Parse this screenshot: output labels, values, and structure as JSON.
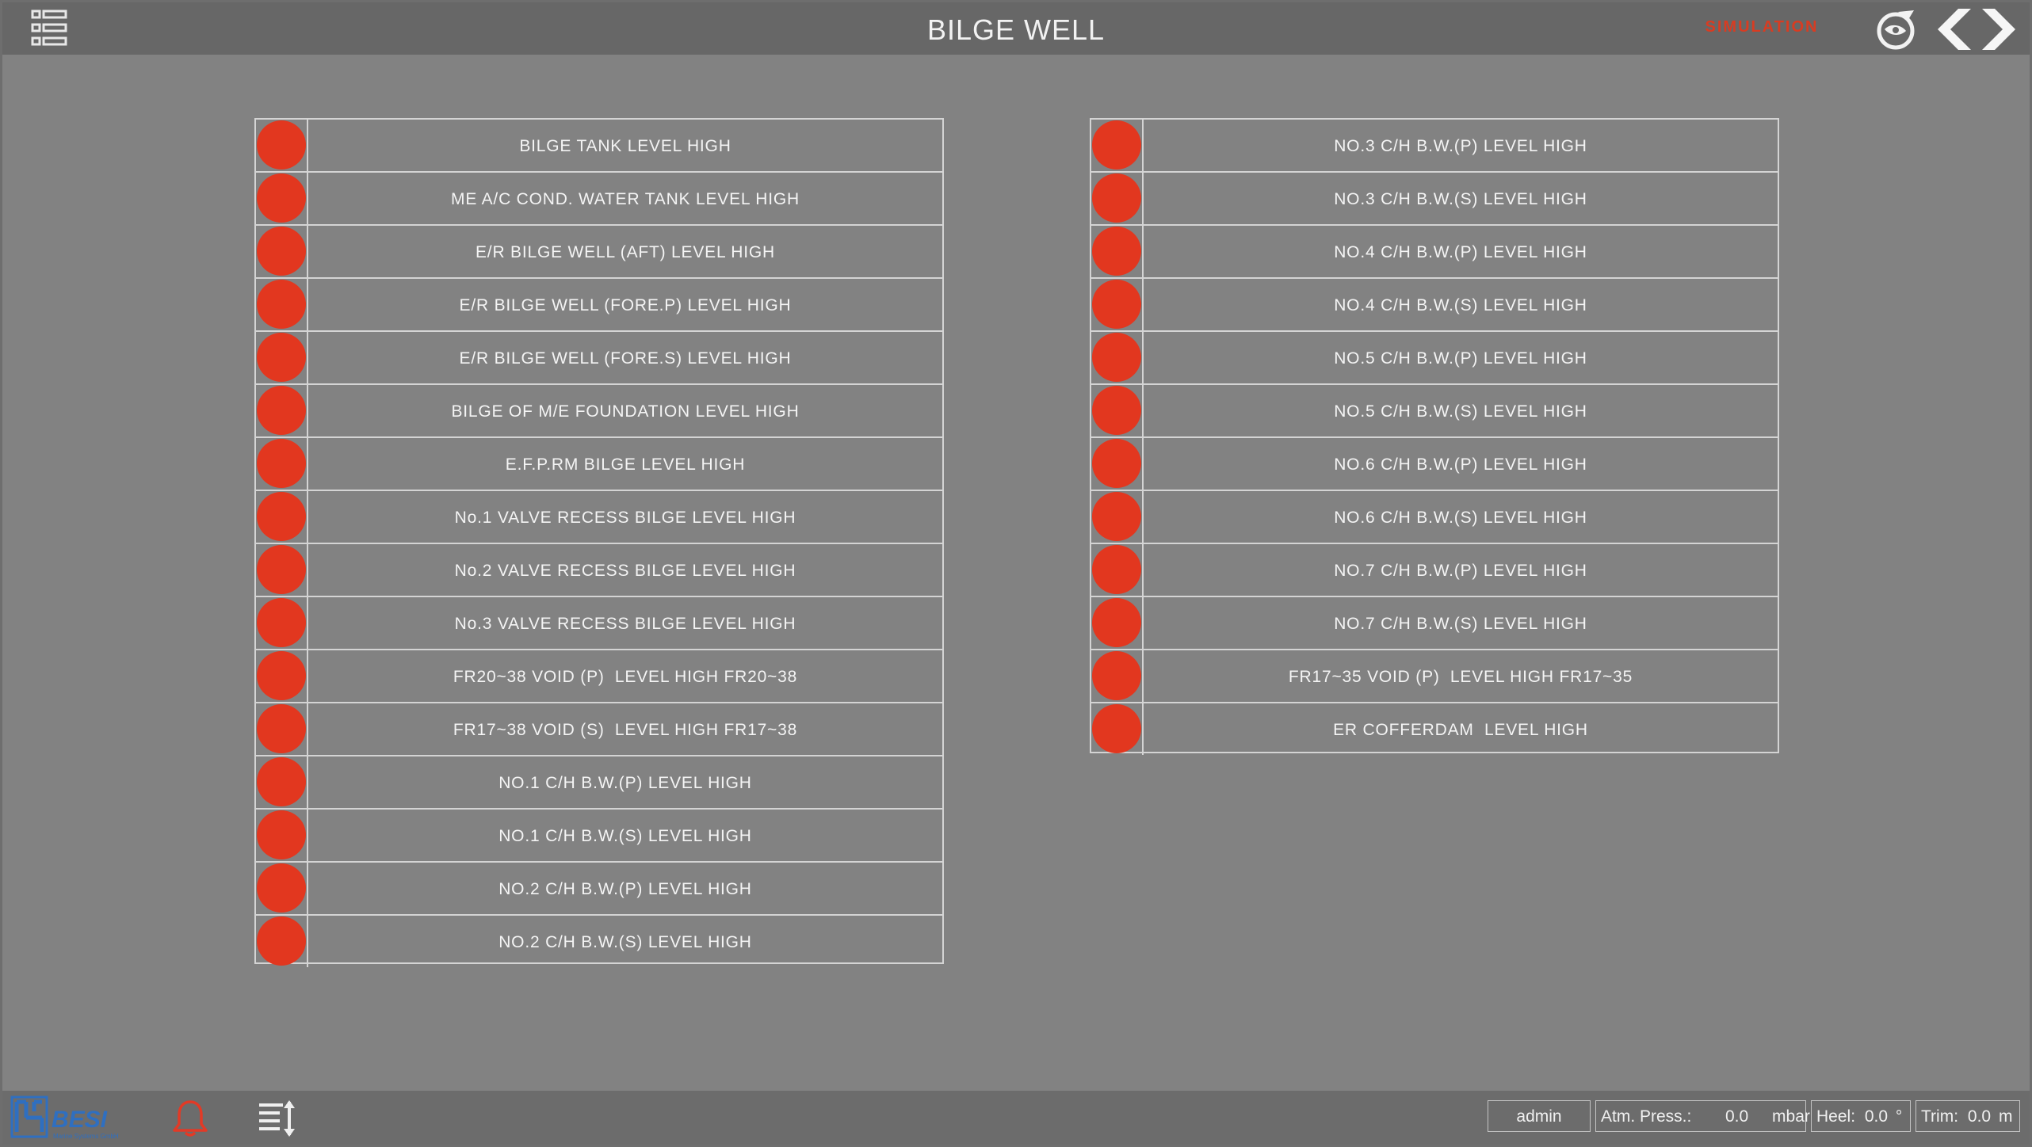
{
  "header": {
    "title": "BILGE WELL",
    "mode_label": "SIMULATION",
    "menu_icon": "list-menu-icon",
    "logo_icon": "ship-wheel-logo-icon",
    "nav_back_icon": "chevron-left-icon",
    "nav_forward_icon": "chevron-right-icon"
  },
  "colors": {
    "alarm_led": "#e2371f",
    "background": "#828282",
    "bar": "#676767",
    "simulation_label": "#d83c22"
  },
  "alarms_left": [
    {
      "label": "BILGE TANK LEVEL HIGH",
      "state": "alarm"
    },
    {
      "label": "ME A/C COND. WATER TANK LEVEL HIGH",
      "state": "alarm"
    },
    {
      "label": "E/R BILGE WELL (AFT) LEVEL HIGH",
      "state": "alarm"
    },
    {
      "label": "E/R BILGE WELL (FORE.P) LEVEL HIGH",
      "state": "alarm"
    },
    {
      "label": "E/R BILGE WELL (FORE.S) LEVEL HIGH",
      "state": "alarm"
    },
    {
      "label": "BILGE OF M/E FOUNDATION LEVEL HIGH",
      "state": "alarm"
    },
    {
      "label": "E.F.P.RM BILGE LEVEL HIGH",
      "state": "alarm"
    },
    {
      "label": "No.1 VALVE RECESS BILGE LEVEL HIGH",
      "state": "alarm"
    },
    {
      "label": "No.2 VALVE RECESS BILGE LEVEL HIGH",
      "state": "alarm"
    },
    {
      "label": "No.3 VALVE RECESS BILGE LEVEL HIGH",
      "state": "alarm"
    },
    {
      "label": "FR20~38 VOID (P)  LEVEL HIGH FR20~38",
      "state": "alarm"
    },
    {
      "label": "FR17~38 VOID (S)  LEVEL HIGH FR17~38",
      "state": "alarm"
    },
    {
      "label": "NO.1 C/H B.W.(P) LEVEL HIGH",
      "state": "alarm"
    },
    {
      "label": "NO.1 C/H B.W.(S) LEVEL HIGH",
      "state": "alarm"
    },
    {
      "label": "NO.2 C/H B.W.(P) LEVEL HIGH",
      "state": "alarm"
    },
    {
      "label": "NO.2 C/H B.W.(S) LEVEL HIGH",
      "state": "alarm"
    }
  ],
  "alarms_right": [
    {
      "label": "NO.3 C/H B.W.(P) LEVEL HIGH",
      "state": "alarm"
    },
    {
      "label": "NO.3 C/H B.W.(S) LEVEL HIGH",
      "state": "alarm"
    },
    {
      "label": "NO.4 C/H B.W.(P) LEVEL HIGH",
      "state": "alarm"
    },
    {
      "label": "NO.4 C/H B.W.(S) LEVEL HIGH",
      "state": "alarm"
    },
    {
      "label": "NO.5 C/H B.W.(P) LEVEL HIGH",
      "state": "alarm"
    },
    {
      "label": "NO.5 C/H B.W.(S) LEVEL HIGH",
      "state": "alarm"
    },
    {
      "label": "NO.6 C/H B.W.(P) LEVEL HIGH",
      "state": "alarm"
    },
    {
      "label": "NO.6 C/H B.W.(S) LEVEL HIGH",
      "state": "alarm"
    },
    {
      "label": "NO.7 C/H B.W.(P) LEVEL HIGH",
      "state": "alarm"
    },
    {
      "label": "NO.7 C/H B.W.(S) LEVEL HIGH",
      "state": "alarm"
    },
    {
      "label": "FR17~35 VOID (P)  LEVEL HIGH FR17~35",
      "state": "alarm"
    },
    {
      "label": "ER COFFERDAM  LEVEL HIGH",
      "state": "alarm"
    }
  ],
  "footer": {
    "logo_icon": "besi-logo",
    "logo_text": "BESI",
    "logo_subtext": "Marine Systems GmbH",
    "alarm_icon": "bell-icon",
    "list_icon": "list-sort-icon",
    "user": "admin",
    "atm_press": {
      "label": "Atm. Press.:",
      "value": "0.0",
      "unit": "mbar"
    },
    "heel": {
      "label": "Heel:",
      "value": "0.0",
      "unit": "°"
    },
    "trim": {
      "label": "Trim:",
      "value": "0.0",
      "unit": "m"
    }
  }
}
